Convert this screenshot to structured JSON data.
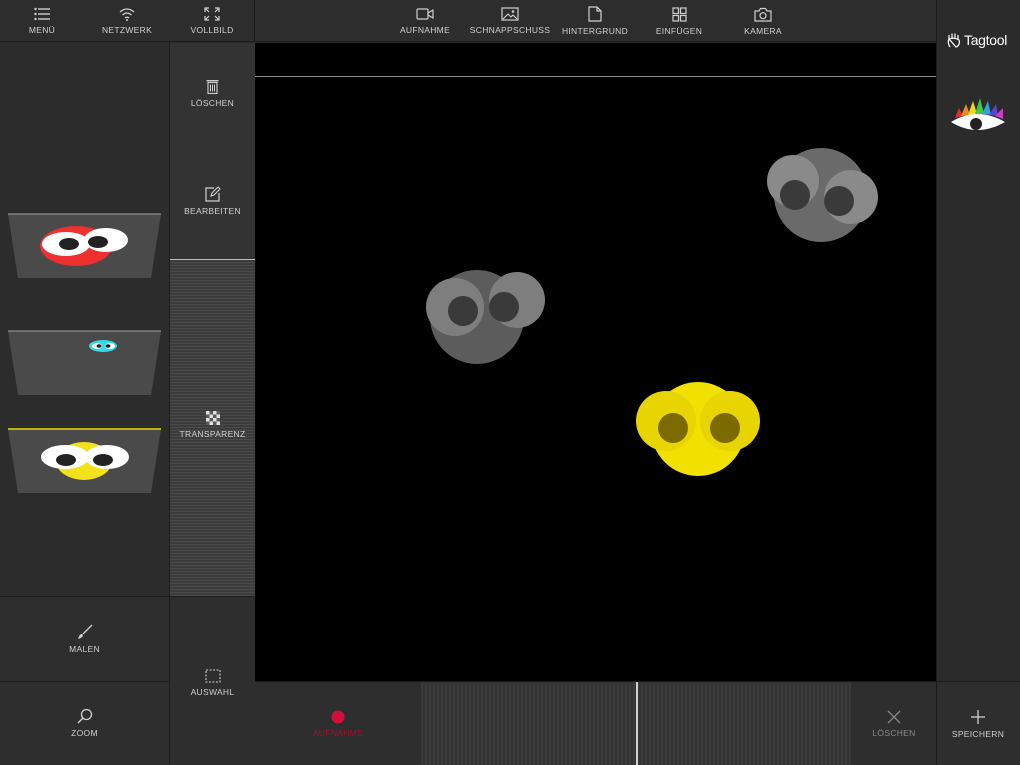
{
  "topbar_left": {
    "menu": "MENÜ",
    "network": "NETZWERK",
    "fullscreen": "VOLLBILD"
  },
  "topbar_center": {
    "record": "AUFNAHME",
    "snapshot": "SCHNAPPSCHUSS",
    "background": "HINTERGRUND",
    "insert": "EINFÜGEN",
    "camera": "KAMERA"
  },
  "brand": {
    "name": "Tagtool"
  },
  "tools": {
    "delete": "LÖSCHEN",
    "edit": "BEARBEITEN",
    "transparency": "TRANSPARENZ"
  },
  "bottom_left": {
    "paint": "MALEN",
    "select": "AUSWAHL",
    "zoom": "ZOOM"
  },
  "bottom_bar": {
    "record": "AUFNAHME",
    "delete": "LÖSCHEN",
    "save": "SPEICHERN"
  },
  "layers": [
    {
      "color": "#ee3030",
      "selected": false
    },
    {
      "color": "#35d8e8",
      "selected": false
    },
    {
      "color": "#f2e21c",
      "selected": true
    }
  ],
  "colors": {
    "accent_record": "#d0103a",
    "selected_layer": "#e8d800",
    "creature_gray": "#6a6a6a",
    "creature_yellow": "#f2e000"
  }
}
